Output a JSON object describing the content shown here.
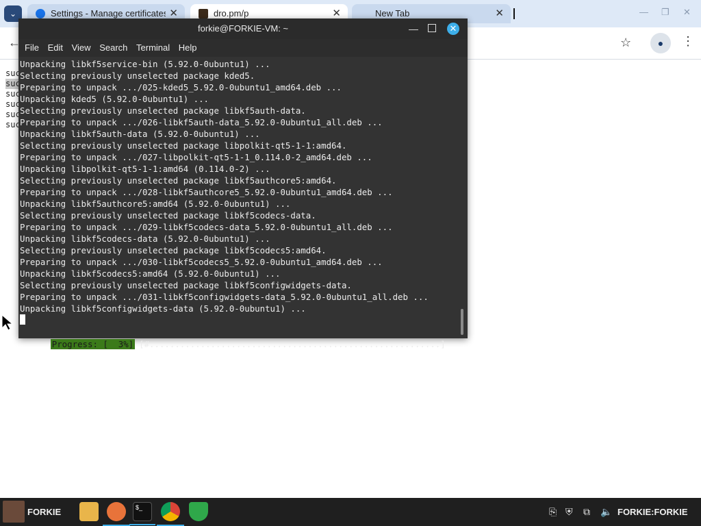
{
  "browser": {
    "tabs": [
      {
        "label": "Settings - Manage certificates",
        "active": false
      },
      {
        "label": "dro.pm/p",
        "active": true
      },
      {
        "label": "New Tab",
        "active": false
      }
    ],
    "page_clip": [
      "suc",
      "suc",
      "suc",
      "suc",
      "suc",
      "suc"
    ]
  },
  "terminal": {
    "title": "forkie@FORKIE-VM: ~",
    "menu": [
      "File",
      "Edit",
      "View",
      "Search",
      "Terminal",
      "Help"
    ],
    "lines": [
      "Unpacking libkf5service-bin (5.92.0-0ubuntu1) ...",
      "Selecting previously unselected package kded5.",
      "Preparing to unpack .../025-kded5_5.92.0-0ubuntu1_amd64.deb ...",
      "Unpacking kded5 (5.92.0-0ubuntu1) ...",
      "Selecting previously unselected package libkf5auth-data.",
      "Preparing to unpack .../026-libkf5auth-data_5.92.0-0ubuntu1_all.deb ...",
      "Unpacking libkf5auth-data (5.92.0-0ubuntu1) ...",
      "Selecting previously unselected package libpolkit-qt5-1-1:amd64.",
      "Preparing to unpack .../027-libpolkit-qt5-1-1_0.114.0-2_amd64.deb ...",
      "Unpacking libpolkit-qt5-1-1:amd64 (0.114.0-2) ...",
      "Selecting previously unselected package libkf5authcore5:amd64.",
      "Preparing to unpack .../028-libkf5authcore5_5.92.0-0ubuntu1_amd64.deb ...",
      "Unpacking libkf5authcore5:amd64 (5.92.0-0ubuntu1) ...",
      "Selecting previously unselected package libkf5codecs-data.",
      "Preparing to unpack .../029-libkf5codecs-data_5.92.0-0ubuntu1_all.deb ...",
      "Unpacking libkf5codecs-data (5.92.0-0ubuntu1) ...",
      "Selecting previously unselected package libkf5codecs5:amd64.",
      "Preparing to unpack .../030-libkf5codecs5_5.92.0-0ubuntu1_amd64.deb ...",
      "Unpacking libkf5codecs5:amd64 (5.92.0-0ubuntu1) ...",
      "Selecting previously unselected package libkf5configwidgets-data.",
      "Preparing to unpack .../031-libkf5configwidgets-data_5.92.0-0ubuntu1_all.deb ...",
      "Unpacking libkf5configwidgets-data (5.92.0-0ubuntu1) ..."
    ],
    "progress_label": "Progress: [  3%]",
    "progress_bar": "[#.........................................................]",
    "progress_percent": 3
  },
  "taskbar": {
    "user": "FORKIE",
    "host": "FORKIE:FORKIE",
    "apps": [
      "folder-icon",
      "firefox-icon",
      "terminal-icon",
      "chrome-icon",
      "shield-icon"
    ]
  }
}
